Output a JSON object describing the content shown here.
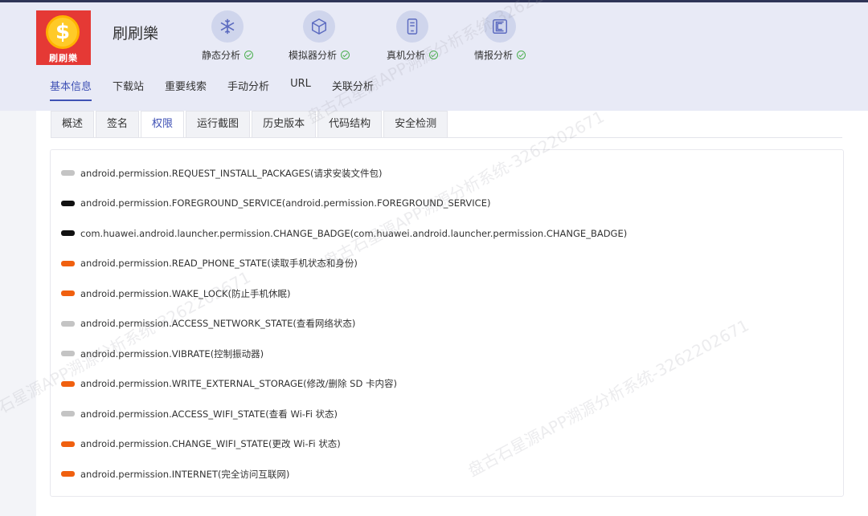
{
  "app": {
    "name": "刷刷樂",
    "logo_text": "刷刷樂",
    "logo_symbol": "$"
  },
  "stages": [
    {
      "label": "静态分析",
      "icon": "snowflake-icon",
      "status": "done"
    },
    {
      "label": "模拟器分析",
      "icon": "cube-icon",
      "status": "done"
    },
    {
      "label": "真机分析",
      "icon": "phone-icon",
      "status": "done"
    },
    {
      "label": "情报分析",
      "icon": "intel-icon",
      "status": "done"
    }
  ],
  "main_nav": [
    {
      "label": "基本信息",
      "active": true
    },
    {
      "label": "下载站",
      "active": false
    },
    {
      "label": "重要线索",
      "active": false
    },
    {
      "label": "手动分析",
      "active": false
    },
    {
      "label": "URL",
      "active": false
    },
    {
      "label": "关联分析",
      "active": false
    }
  ],
  "sub_tabs": [
    {
      "label": "概述",
      "active": false
    },
    {
      "label": "签名",
      "active": false
    },
    {
      "label": "权限",
      "active": true
    },
    {
      "label": "运行截图",
      "active": false
    },
    {
      "label": "历史版本",
      "active": false
    },
    {
      "label": "代码结构",
      "active": false
    },
    {
      "label": "安全检测",
      "active": false
    }
  ],
  "permission_colors": {
    "normal": "#c4c4c4",
    "signature": "#111111",
    "dangerous": "#f0600f"
  },
  "permissions": [
    {
      "text": "android.permission.REQUEST_INSTALL_PACKAGES(请求安装文件包)",
      "level": "normal"
    },
    {
      "text": "android.permission.FOREGROUND_SERVICE(android.permission.FOREGROUND_SERVICE)",
      "level": "signature"
    },
    {
      "text": "com.huawei.android.launcher.permission.CHANGE_BADGE(com.huawei.android.launcher.permission.CHANGE_BADGE)",
      "level": "signature"
    },
    {
      "text": "android.permission.READ_PHONE_STATE(读取手机状态和身份)",
      "level": "dangerous"
    },
    {
      "text": "android.permission.WAKE_LOCK(防止手机休眠)",
      "level": "dangerous"
    },
    {
      "text": "android.permission.ACCESS_NETWORK_STATE(查看网络状态)",
      "level": "normal"
    },
    {
      "text": "android.permission.VIBRATE(控制振动器)",
      "level": "normal"
    },
    {
      "text": "android.permission.WRITE_EXTERNAL_STORAGE(修改/删除 SD 卡内容)",
      "level": "dangerous"
    },
    {
      "text": "android.permission.ACCESS_WIFI_STATE(查看 Wi-Fi 状态)",
      "level": "normal"
    },
    {
      "text": "android.permission.CHANGE_WIFI_STATE(更改 Wi-Fi 状态)",
      "level": "dangerous"
    },
    {
      "text": "android.permission.INTERNET(完全访问互联网)",
      "level": "dangerous"
    }
  ],
  "watermark": "盘古石星源APP溯源分析系统-3262202671"
}
